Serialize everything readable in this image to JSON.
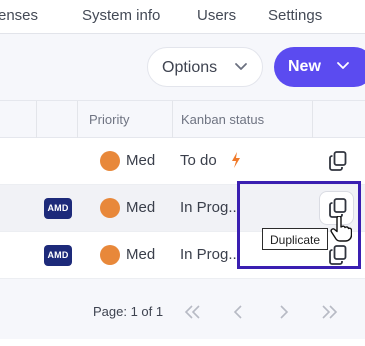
{
  "topnav": {
    "items": [
      {
        "label": "enses"
      },
      {
        "label": "System info"
      },
      {
        "label": "Users"
      },
      {
        "label": "Settings"
      }
    ]
  },
  "toolbar": {
    "options_label": "Options",
    "new_label": "New",
    "new_color": "#5b4bf0"
  },
  "table": {
    "headers": {
      "priority": "Priority",
      "kanban": "Kanban status"
    },
    "rows": [
      {
        "vendor": "",
        "priority": "Med",
        "priority_color": "#e8883a",
        "kanban": "To do",
        "kanban_icon": "bolt-icon"
      },
      {
        "vendor": "AMD",
        "priority": "Med",
        "priority_color": "#e8883a",
        "kanban": "In Prog..."
      },
      {
        "vendor": "AMD",
        "priority": "Med",
        "priority_color": "#e8883a",
        "kanban": "In Prog..."
      }
    ]
  },
  "tooltip": {
    "text": "Duplicate"
  },
  "pagination": {
    "label": "Page: 1 of 1"
  },
  "icons": {
    "duplicate": "duplicate-icon",
    "chevron": "chevron-down-icon",
    "first": "double-chevron-left-icon",
    "prev": "chevron-left-icon",
    "next": "chevron-right-icon",
    "last": "double-chevron-right-icon"
  }
}
